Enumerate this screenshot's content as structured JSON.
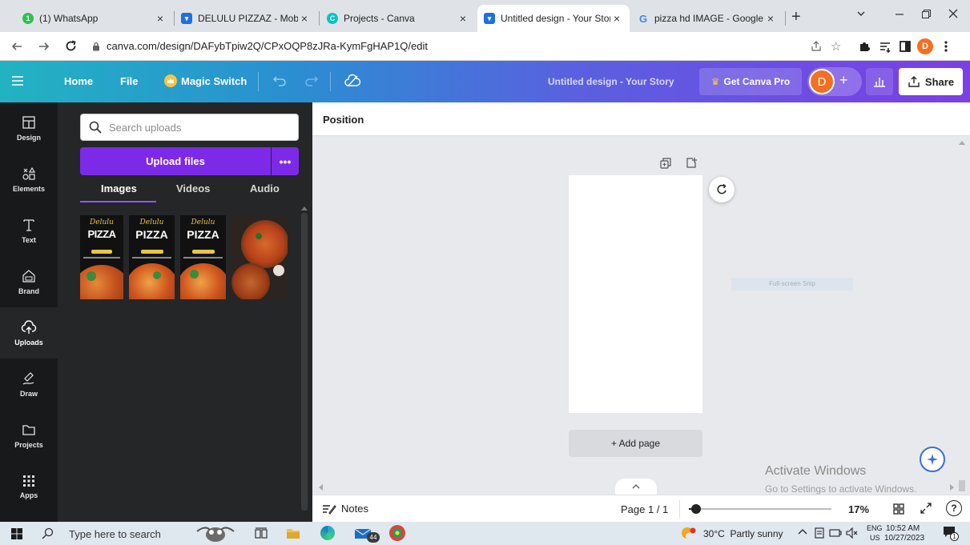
{
  "browser": {
    "tabs": [
      {
        "title": "(1) WhatsApp",
        "close": "×"
      },
      {
        "title": "DELULU PIZZAZ - Mobile Vi",
        "close": "×"
      },
      {
        "title": "Projects - Canva",
        "close": "×"
      },
      {
        "title": "Untitled design - Your Story",
        "close": "×"
      },
      {
        "title": "pizza hd IMAGE - Google Se",
        "close": "×"
      }
    ],
    "new_tab": "+",
    "url": "canva.com/design/DAFybTpiw2Q/CPxOQP8zJRa-KymFgHAP1Q/edit",
    "profile_initial": "D"
  },
  "header": {
    "home": "Home",
    "file": "File",
    "magic_switch": "Magic Switch",
    "design_title": "Untitled design - Your Story",
    "get_pro": "Get Canva Pro",
    "avatar_initial": "D",
    "add": "+",
    "share": "Share"
  },
  "rail": {
    "items": [
      {
        "label": "Design",
        "icon": "layout-icon"
      },
      {
        "label": "Elements",
        "icon": "shapes-icon"
      },
      {
        "label": "Text",
        "icon": "text-icon"
      },
      {
        "label": "Brand",
        "icon": "brand-icon"
      },
      {
        "label": "Uploads",
        "icon": "cloud-upload-icon"
      },
      {
        "label": "Draw",
        "icon": "draw-icon"
      },
      {
        "label": "Projects",
        "icon": "folder-icon"
      },
      {
        "label": "Apps",
        "icon": "grid-icon"
      }
    ]
  },
  "panel": {
    "search_placeholder": "Search uploads",
    "upload_button": "Upload files",
    "more": "•••",
    "tabs": [
      "Images",
      "Videos",
      "Audio"
    ],
    "thumbs": [
      {
        "brand": "Delulu",
        "word": "PIZZA"
      },
      {
        "brand": "Delulu",
        "word": "PIZZA"
      },
      {
        "brand": "Delulu",
        "word": "PIZZA"
      }
    ]
  },
  "canvas": {
    "context_label": "Position",
    "add_page": "+ Add page",
    "ghost_text": "Full-screen Snip",
    "watermark_title": "Activate Windows",
    "watermark_sub": "Go to Settings to activate Windows."
  },
  "footer": {
    "notes": "Notes",
    "page": "Page 1 / 1",
    "zoom": "17%",
    "zoom_level": 0.05
  },
  "taskbar": {
    "search_placeholder": "Type here to search",
    "mail_count": "44",
    "weather": "30°C  Partly sunny",
    "lang_top": "ENG",
    "lang_bottom": "US",
    "time": "10:52 AM",
    "date": "10/27/2023",
    "notif": "1"
  },
  "colors": {
    "accent_purple": "#7d2ae8",
    "rail_bg": "#18191b",
    "panel_bg": "#252627",
    "avatar_orange": "#f36f21",
    "whatsapp_green": "#2ec14d"
  }
}
